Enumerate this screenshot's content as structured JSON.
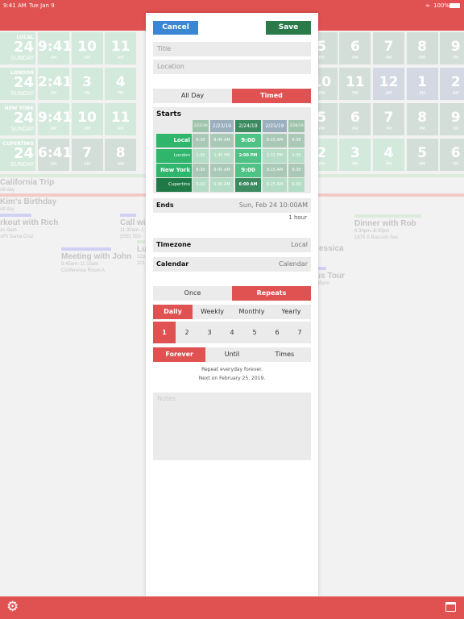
{
  "status": {
    "time": "9:41 AM",
    "date": "Tue Jan 9",
    "battery": "100%"
  },
  "grid": {
    "rows": [
      {
        "city": "LOCAL",
        "day": "24",
        "weekday": "SUNDAY",
        "cells": [
          [
            "9:41",
            "AM"
          ],
          [
            "10",
            "AM"
          ],
          [
            "11",
            "AM"
          ],
          [
            "5",
            "PM"
          ],
          [
            "6",
            "PM"
          ],
          [
            "7",
            "PM"
          ],
          [
            "8",
            "PM"
          ],
          [
            "9",
            "PM"
          ]
        ]
      },
      {
        "city": "LONDON",
        "day": "24",
        "weekday": "SUNDAY",
        "cells": [
          [
            "2:41",
            "PM"
          ],
          [
            "3",
            "PM"
          ],
          [
            "4",
            "PM"
          ],
          [
            "10",
            "PM"
          ],
          [
            "11",
            "PM"
          ],
          [
            "12",
            "AM"
          ],
          [
            "1",
            "AM"
          ],
          [
            "2",
            "AM"
          ]
        ]
      },
      {
        "city": "NEW YORK",
        "day": "24",
        "weekday": "SUNDAY",
        "cells": [
          [
            "9:41",
            "AM"
          ],
          [
            "10",
            "AM"
          ],
          [
            "11",
            "AM"
          ],
          [
            "5",
            "PM"
          ],
          [
            "6",
            "PM"
          ],
          [
            "7",
            "PM"
          ],
          [
            "8",
            "PM"
          ],
          [
            "9",
            "PM"
          ]
        ]
      },
      {
        "city": "CUPERTINO",
        "day": "24",
        "weekday": "SUNDAY",
        "cells": [
          [
            "6:41",
            "AM"
          ],
          [
            "7",
            "AM"
          ],
          [
            "8",
            "AM"
          ],
          [
            "2",
            "PM"
          ],
          [
            "3",
            "PM"
          ],
          [
            "4",
            "PM"
          ],
          [
            "5",
            "PM"
          ],
          [
            "6",
            "PM"
          ]
        ]
      }
    ]
  },
  "events": [
    {
      "title": "California Trip",
      "sub1": "All day",
      "sub2": "",
      "color": "#dcebdc"
    },
    {
      "title": "Kim's Birthday",
      "sub1": "All day",
      "sub2": "",
      "color": "#f5c8c8"
    },
    {
      "title": "orkout with Rich",
      "sub1": "0am–9am",
      "sub2": "ossFit Santa Cruz",
      "color": "#d0d0f5"
    },
    {
      "title": "Call wi",
      "sub1": "11:30am–1",
      "sub2": "(555) 555-",
      "color": "#d0d0f5"
    },
    {
      "title": "Meeting with John",
      "sub1": "9:45am–11:15am",
      "sub2": "Conference Room A",
      "color": "#d0d0f5"
    },
    {
      "title": "Lu",
      "sub1": "12p",
      "sub2": "101",
      "color": "#dcebdc"
    },
    {
      "title": "Dinner with Rob",
      "sub1": "6:30pm–8:30pm",
      "sub2": "1875 S Bascom Ave",
      "color": "#dcebdc"
    },
    {
      "title": "essica",
      "sub1": "",
      "sub2": "",
      "color": ""
    },
    {
      "title": "us Tour",
      "sub1": ":45pm",
      "sub2": "",
      "color": "#d0d0f5"
    }
  ],
  "modal": {
    "cancel": "Cancel",
    "save": "Save",
    "title_placeholder": "Title",
    "location_placeholder": "Location",
    "allday_tabs": [
      "All Day",
      "Timed"
    ],
    "starts_label": "Starts",
    "dates": [
      "2/22/19",
      "2/23/19",
      "2/24/19",
      "2/25/19",
      "2/26/19"
    ],
    "start_rows": [
      {
        "tz": "Local",
        "times": [
          "8:30 AM",
          "8:45 AM",
          "9:00 AM",
          "9:15 AM",
          "9:30 AM"
        ]
      },
      {
        "tz": "London",
        "times": [
          "1:30 PM",
          "1:45 PM",
          "2:00 PM",
          "2:15 PM",
          "2:30 PM"
        ]
      },
      {
        "tz": "New York",
        "times": [
          "8:30 AM",
          "8:45 AM",
          "9:00 AM",
          "9:15 AM",
          "9:30 AM"
        ]
      },
      {
        "tz": "Cupertino",
        "times": [
          "5:30 AM",
          "5:45 AM",
          "6:00 AM",
          "6:15 AM",
          "6:30 AM"
        ]
      }
    ],
    "ends_label": "Ends",
    "ends_value": "Sun, Feb 24 10:00AM",
    "duration": "1 hour",
    "timezone_label": "Timezone",
    "timezone_value": "Local",
    "calendar_label": "Calendar",
    "calendar_value": "Calendar",
    "repeat_tabs": [
      "Once",
      "Repeats"
    ],
    "freq_tabs": [
      "Daily",
      "Weekly",
      "Monthly",
      "Yearly"
    ],
    "interval": [
      "1",
      "2",
      "3",
      "4",
      "5",
      "6",
      "7"
    ],
    "end_tabs": [
      "Forever",
      "Until",
      "Times"
    ],
    "summary1": "Repeat everyday forever.",
    "summary2": "Next on February 25, 2019.",
    "notes_placeholder": "Notes"
  },
  "colors": {
    "red": "#e05252",
    "blue": "#3a86d4",
    "green": "#2a7a4a",
    "tz_green": "#2fb56c"
  }
}
